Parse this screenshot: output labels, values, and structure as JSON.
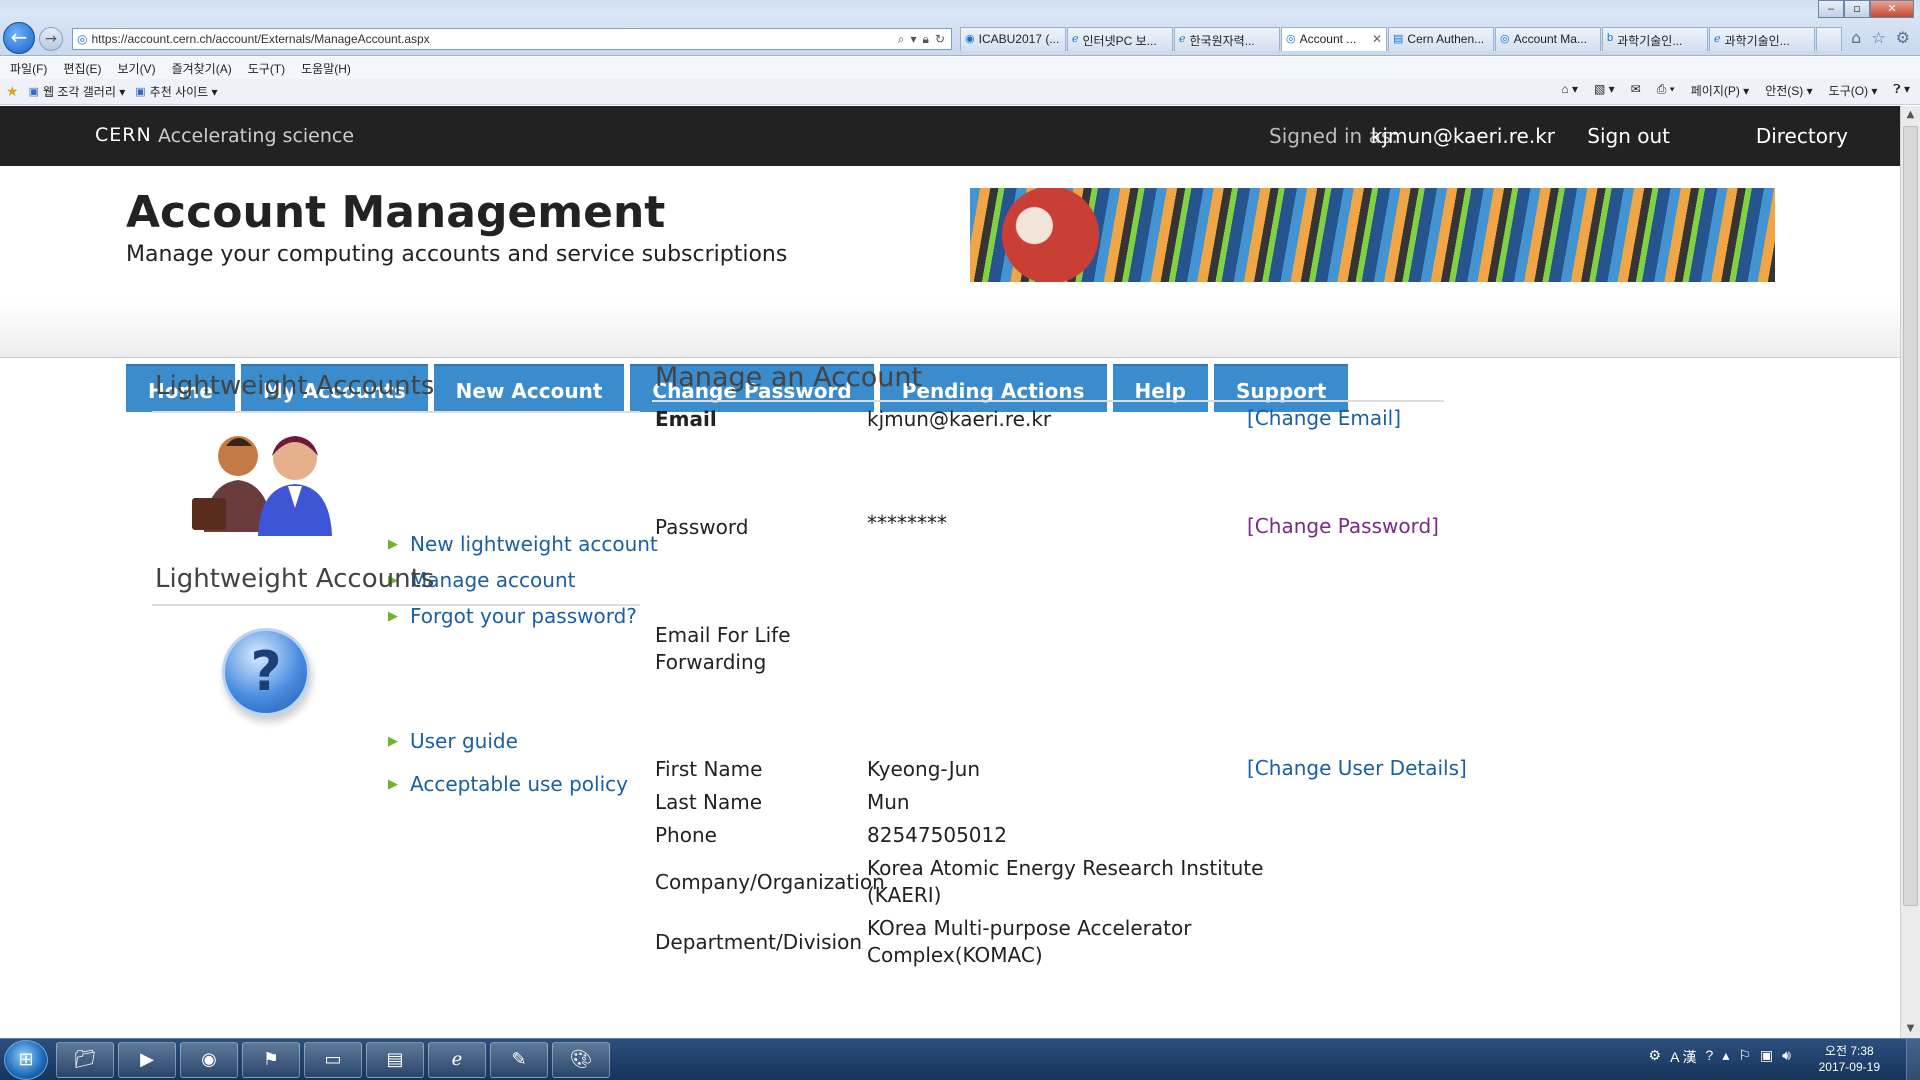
{
  "browser": {
    "url": "https://account.cern.ch/account/Externals/ManageAccount.aspx",
    "tabs": [
      {
        "label": "ICABU2017 (...",
        "active": false
      },
      {
        "label": "인터넷PC 보...",
        "active": false
      },
      {
        "label": "한국원자력...",
        "active": false
      },
      {
        "label": "Account ...",
        "active": true
      },
      {
        "label": "Cern Authen...",
        "active": false
      },
      {
        "label": "Account Ma...",
        "active": false
      },
      {
        "label": "과학기술인...",
        "active": false
      },
      {
        "label": "과학기술인...",
        "active": false
      }
    ],
    "menu": [
      "파일(F)",
      "편집(E)",
      "보기(V)",
      "즐겨찾기(A)",
      "도구(T)",
      "도움말(H)"
    ],
    "favorites": [
      "웹 조각 갤러리 ▾",
      "추천 사이트 ▾"
    ],
    "commands": [
      "페이지(P) ▾",
      "안전(S) ▾",
      "도구(O) ▾"
    ]
  },
  "cern_bar": {
    "brand": "CERN",
    "tagline": "Accelerating science",
    "signed_in_label": "Signed in as:",
    "user": "kjmun@kaeri.re.kr",
    "sign_out": "Sign out",
    "directory": "Directory"
  },
  "header": {
    "title": "Account Management",
    "subtitle": "Manage your computing accounts and service subscriptions"
  },
  "nav": [
    "Home",
    "My Accounts",
    "New Account",
    "Change Password",
    "Pending Actions",
    "Help",
    "Support"
  ],
  "sidebar": {
    "section1": {
      "title": "Lightweight Accounts",
      "links": [
        "New lightweight account",
        "Manage account",
        "Forgot your password?"
      ]
    },
    "section2": {
      "title": "Lightweight Accounts",
      "links": [
        "User guide",
        "Acceptable use policy"
      ]
    }
  },
  "manage": {
    "title": "Manage an Account",
    "email": {
      "label": "Email",
      "value": "kjmun@kaeri.re.kr",
      "action": "[Change Email]"
    },
    "password": {
      "label": "Password",
      "value": "********",
      "action": "[Change Password]"
    },
    "forwarding": {
      "label_line1": "Email For Life",
      "label_line2": "Forwarding"
    },
    "first_name": {
      "label": "First Name",
      "value": "Kyeong-Jun",
      "action": "[Change User Details]"
    },
    "last_name": {
      "label": "Last Name",
      "value": "Mun"
    },
    "phone": {
      "label": "Phone",
      "value": "82547505012"
    },
    "company": {
      "label": "Company/Organization",
      "value_line1": "Korea Atomic Energy Research Institute",
      "value_line2": "(KAERI)"
    },
    "department": {
      "label": "Department/Division",
      "value_line1": "KOrea Multi-purpose Accelerator",
      "value_line2": "Complex(KOMAC)"
    }
  },
  "taskbar": {
    "clock_time": "오전 7:38",
    "clock_date": "2017-09-19",
    "ime": "A 漢"
  },
  "colors": {
    "nav_tab": "#3a8ccd",
    "link": "#1a5fa5",
    "visited_link": "#7a2a8a",
    "top_bar": "#222222"
  }
}
